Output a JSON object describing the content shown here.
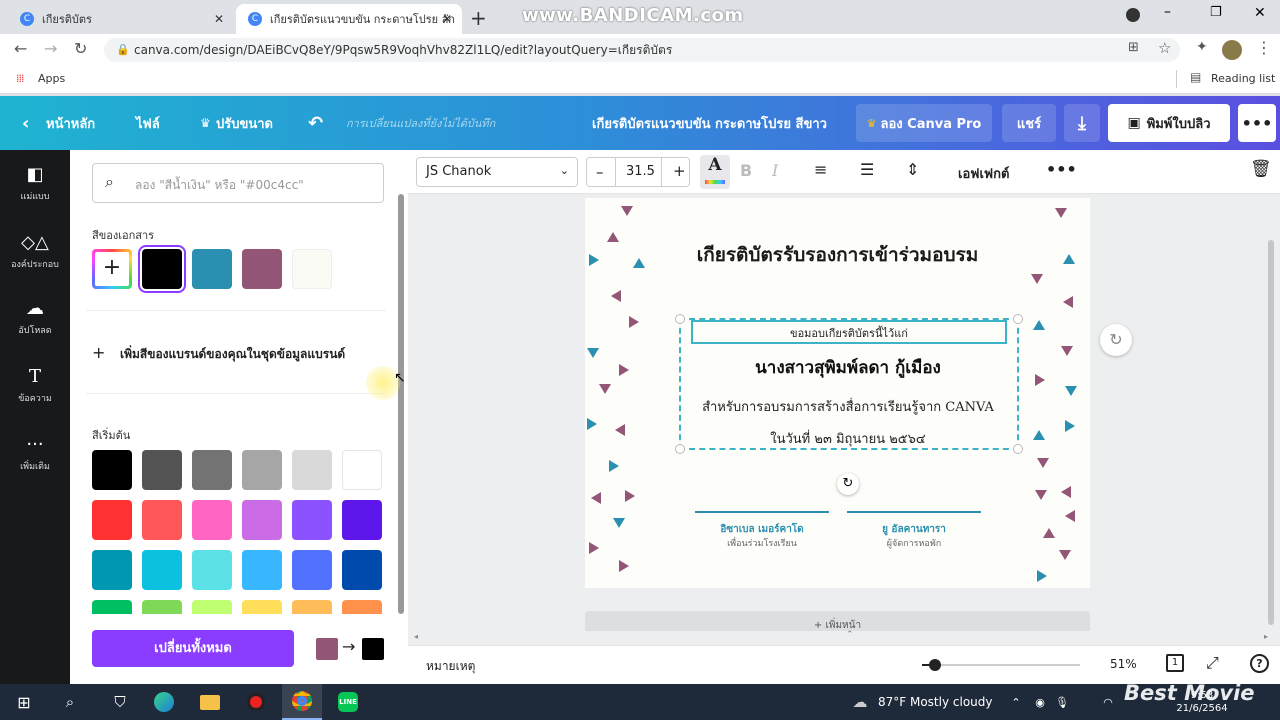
{
  "browser": {
    "tabs": [
      {
        "title": "เกียรติบัตร",
        "active": false
      },
      {
        "title": "เกียรติบัตรแนวขบขัน กระดาษโปรย ลัก",
        "active": true
      }
    ],
    "watermark": "www.BANDICAM.com",
    "url": "canva.com/design/DAEiBCvQ8eY/9Pqsw5R9VoqhVhv82Zl1LQ/edit?layoutQuery=เกียรติบัตร",
    "bookmarks_apps": "Apps",
    "reading_list": "Reading list"
  },
  "canva_top": {
    "home": "หน้าหลัก",
    "file": "ไฟล์",
    "resize": "ปรับขนาด",
    "unsaved": "การเปลี่ยนแปลงที่ยังไม่ได้บันทึก",
    "title": "เกียรติบัตรแนวขบขัน กระดาษโปรย สีขาว",
    "try_pro": "ลอง Canva Pro",
    "share": "แชร์",
    "print": "พิมพ์ใบปลิว"
  },
  "left_rail": [
    {
      "label": "แม่แบบ",
      "icon": "template-icon"
    },
    {
      "label": "องค์ประกอบ",
      "icon": "elements-icon"
    },
    {
      "label": "อัปโหลด",
      "icon": "upload-icon"
    },
    {
      "label": "ข้อความ",
      "icon": "text-icon"
    },
    {
      "label": "เพิ่มเติม",
      "icon": "more-icon"
    }
  ],
  "panel": {
    "search_placeholder": "ลอง \"สีน้ำเงิน\" หรือ \"#00c4cc\"",
    "doc_colors_title": "สีของเอกสาร",
    "doc_colors": [
      "#000000",
      "#2a8fb0",
      "#935676",
      "#fbfbf5"
    ],
    "add_brand": "เพิ่มสีของแบรนด์ของคุณในชุดข้อมูลแบรนด์",
    "default_title": "สีเริ่มต้น",
    "default_colors": [
      [
        "#000000",
        "#545454",
        "#737373",
        "#a6a6a6",
        "#d9d9d9",
        "#ffffff"
      ],
      [
        "#ff3131",
        "#ff5757",
        "#ff66c4",
        "#cb6ce6",
        "#8c52ff",
        "#5e17eb"
      ],
      [
        "#0097b2",
        "#0cc0df",
        "#5ce1e6",
        "#38b6ff",
        "#5271ff",
        "#004aad"
      ],
      [
        "#00bf63",
        "#7ed957",
        "#c1ff72",
        "#ffde59",
        "#ffbd59",
        "#ff914d"
      ]
    ],
    "replace_all": "เปลี่ยนทั้งหมด",
    "replace_from": "#935676",
    "replace_to": "#000000"
  },
  "toolbar": {
    "font": "JS Chanok",
    "size": "31.5",
    "effects": "เอฟเฟกต์"
  },
  "certificate": {
    "title": "เกียรติบัตรรับรองการเข้าร่วมอบรม",
    "line1": "ขอมอบเกียรติบัตรนี้ไว้แก่",
    "name": "นางสาวสุพิมพ์ลดา กู้เมือง",
    "line3": "สำหรับการอบรมการสร้างสื่อการเรียนรู้จาก CANVA",
    "date": "ในวันที่ ๒๓ มิถุนายน ๒๕๖๔",
    "sign1_name": "อิซาเบล เมอร์คาโด",
    "sign1_role": "เพื่อนร่วมโรงเรียน",
    "sign2_name": "ยู อัลคานทารา",
    "sign2_role": "ผู้จัดการหอพัก",
    "next_page": "+ เพิ่มหน้า"
  },
  "bottom": {
    "notes": "หมายเหตุ",
    "zoom": "51%",
    "page_num": "1"
  },
  "taskbar": {
    "weather": "87°F  Mostly cloudy",
    "time": "9:53",
    "date": "21/6/2564",
    "brand": "Best Movie"
  },
  "colors": {
    "accent": "#8b3dff",
    "teal": "#2a8fb0",
    "mauve": "#935676"
  }
}
